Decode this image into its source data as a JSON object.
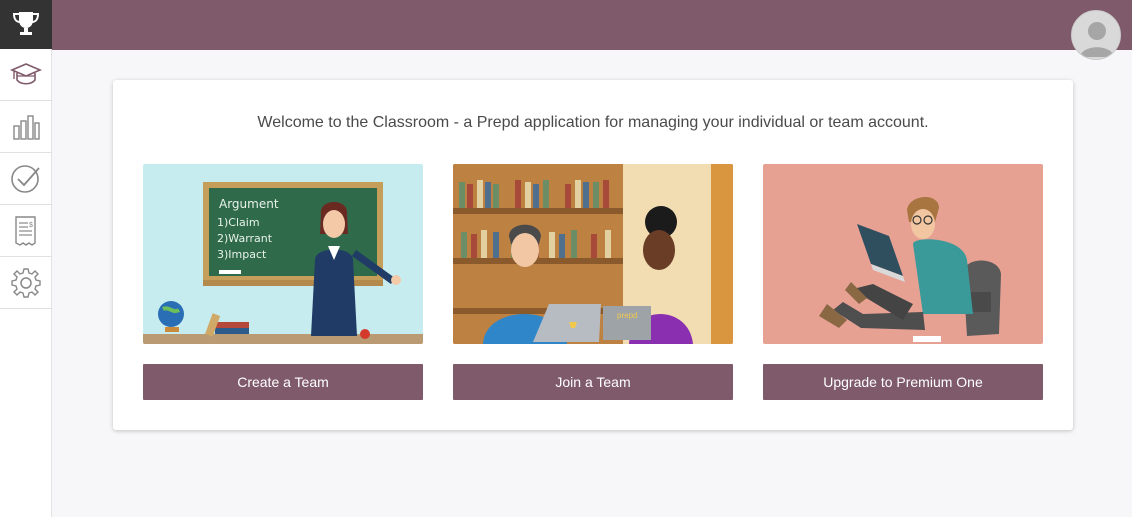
{
  "sidebar": {
    "items": [
      {
        "icon": "trophy-icon"
      },
      {
        "icon": "graduation-cap-icon"
      },
      {
        "icon": "bar-chart-icon"
      },
      {
        "icon": "check-circle-icon"
      },
      {
        "icon": "receipt-icon"
      },
      {
        "icon": "gear-icon"
      }
    ]
  },
  "header": {
    "avatar_icon": "user-avatar-icon"
  },
  "main": {
    "welcome": "Welcome to the Classroom - a Prepd application for managing your individual or team account.",
    "options": [
      {
        "button": "Create a Team",
        "chalkboard": [
          "Argument",
          "1)Claim",
          "2)Warrant",
          "3)Impact"
        ]
      },
      {
        "button": "Join a Team",
        "laptop_label": "prepd"
      },
      {
        "button": "Upgrade to Premium One"
      }
    ]
  },
  "colors": {
    "brand": "#7f5a6a",
    "sidebar_active": "#333333"
  }
}
